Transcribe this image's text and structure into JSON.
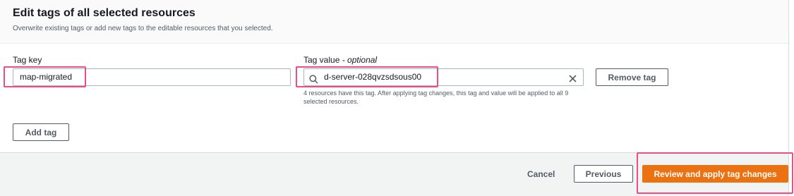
{
  "header": {
    "title": "Edit tags of all selected resources",
    "description": "Overwrite existing tags or add new tags to the editable resources that you selected."
  },
  "tag_row": {
    "key_label": "Tag key",
    "key_value": "map-migrated",
    "value_label": "Tag value",
    "value_label_suffix": "- optional",
    "value_value": "d-server-028qvzsdsous00",
    "hint": "4 resources have this tag. After applying tag changes, this tag and value will be applied to all 9 selected resources.",
    "remove_label": "Remove tag",
    "search_icon": "search-icon",
    "clear_icon": "close-icon"
  },
  "add_tag_label": "Add tag",
  "footer": {
    "cancel_label": "Cancel",
    "previous_label": "Previous",
    "apply_label": "Review and apply tag changes"
  },
  "colors": {
    "primary": "#ec7211",
    "highlight": "#ec4d84"
  }
}
